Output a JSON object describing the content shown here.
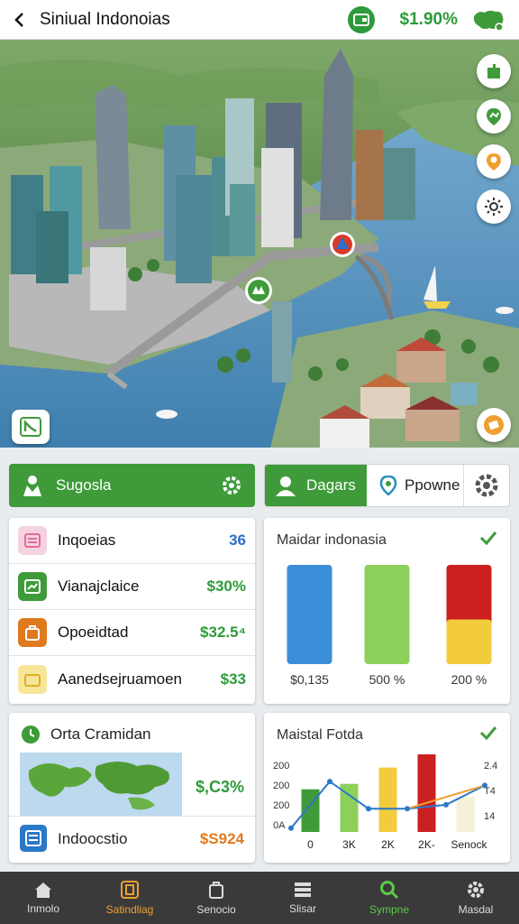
{
  "header": {
    "title": "Siniual Indonoias",
    "balance": "$1.90%",
    "icons": [
      "back-arrow-icon",
      "wallet-icon",
      "map-icon"
    ]
  },
  "map": {
    "side_buttons": [
      "build-icon",
      "location-pin-icon",
      "map-marker-icon",
      "sun-icon"
    ],
    "bottom_left_icon": "route-icon",
    "bottom_right_icon": "coin-icon",
    "markers": [
      "warning-marker-icon",
      "park-marker-icon"
    ]
  },
  "tabs": {
    "primary_label": "Sugosla",
    "group": [
      {
        "label": "Dagars",
        "icon": "user-icon"
      },
      {
        "label": "Ppowne",
        "icon": "pin-icon"
      }
    ]
  },
  "list": [
    {
      "label": "Inqoeias",
      "value": "36",
      "icon": "document-icon",
      "color": "#e46b9a",
      "value_color": "#2a6fc9"
    },
    {
      "label": "Vianajclaice",
      "value": "$30%",
      "icon": "chart-icon",
      "color": "#3f9b3a",
      "value_color": "#2e9a3a"
    },
    {
      "label": "Opoeidtad",
      "value": "$32.5⁴",
      "icon": "bag-icon",
      "color": "#e07a1f",
      "value_color": "#2e9a3a"
    },
    {
      "label": "Aanedsejruamoen",
      "value": "$33",
      "icon": "folder-icon",
      "color": "#f1cc3c",
      "value_color": "#2e9a3a"
    }
  ],
  "bar_card": {
    "title": "Maidar indonasia",
    "chart_data": {
      "type": "bar",
      "categories": [
        "$0,135",
        "500 %",
        "200 %"
      ],
      "series": [
        {
          "values": [
            1.0,
            1.0,
            1.0
          ]
        }
      ],
      "colors": [
        "#3a8fd8",
        "#8cd05a",
        "#cc1f1f"
      ],
      "secondary_fill": {
        "category": "200 %",
        "color": "#f2cc3c",
        "fraction": 0.45
      }
    }
  },
  "geo_card": {
    "title": "Orta Cramidan",
    "value": "$,C3%",
    "row_label": "Indoocstio",
    "row_value": "$S924",
    "row_value_color": "#e07a1f"
  },
  "line_card": {
    "title": "Maistal Fotda",
    "chart_data": {
      "type": "bar",
      "categories": [
        "0",
        "3K",
        "2K",
        "2K-",
        "Senock"
      ],
      "y_ticks_left": [
        "200",
        "200",
        "200",
        "0A"
      ],
      "y_ticks_right": [
        "2.4",
        "T4",
        "14"
      ],
      "series": [
        {
          "name": "",
          "values": [
            0.55,
            0.62,
            0.83,
            1.0,
            0.45
          ]
        },
        {
          "name": "",
          "values": [
            0.05,
            0.65,
            0.3,
            0.3,
            0.35,
            0.6
          ]
        }
      ],
      "bar_colors": [
        "#3f9b3a",
        "#8cd05a",
        "#f2cc3c",
        "#cc1f1f",
        "#f5f0d8"
      ]
    }
  },
  "nav": [
    {
      "label": "Inmolo",
      "icon": "home-icon",
      "color": "#dddddd"
    },
    {
      "label": "Satindliag",
      "icon": "building-icon",
      "color": "#f0a030"
    },
    {
      "label": "Senocio",
      "icon": "bag-icon",
      "color": "#dddddd"
    },
    {
      "label": "Slisar",
      "icon": "list-icon",
      "color": "#dddddd"
    },
    {
      "label": "Sympne",
      "icon": "search-icon",
      "color": "#5cc94a"
    },
    {
      "label": "Masdal",
      "icon": "gear-icon",
      "color": "#dddddd"
    }
  ]
}
